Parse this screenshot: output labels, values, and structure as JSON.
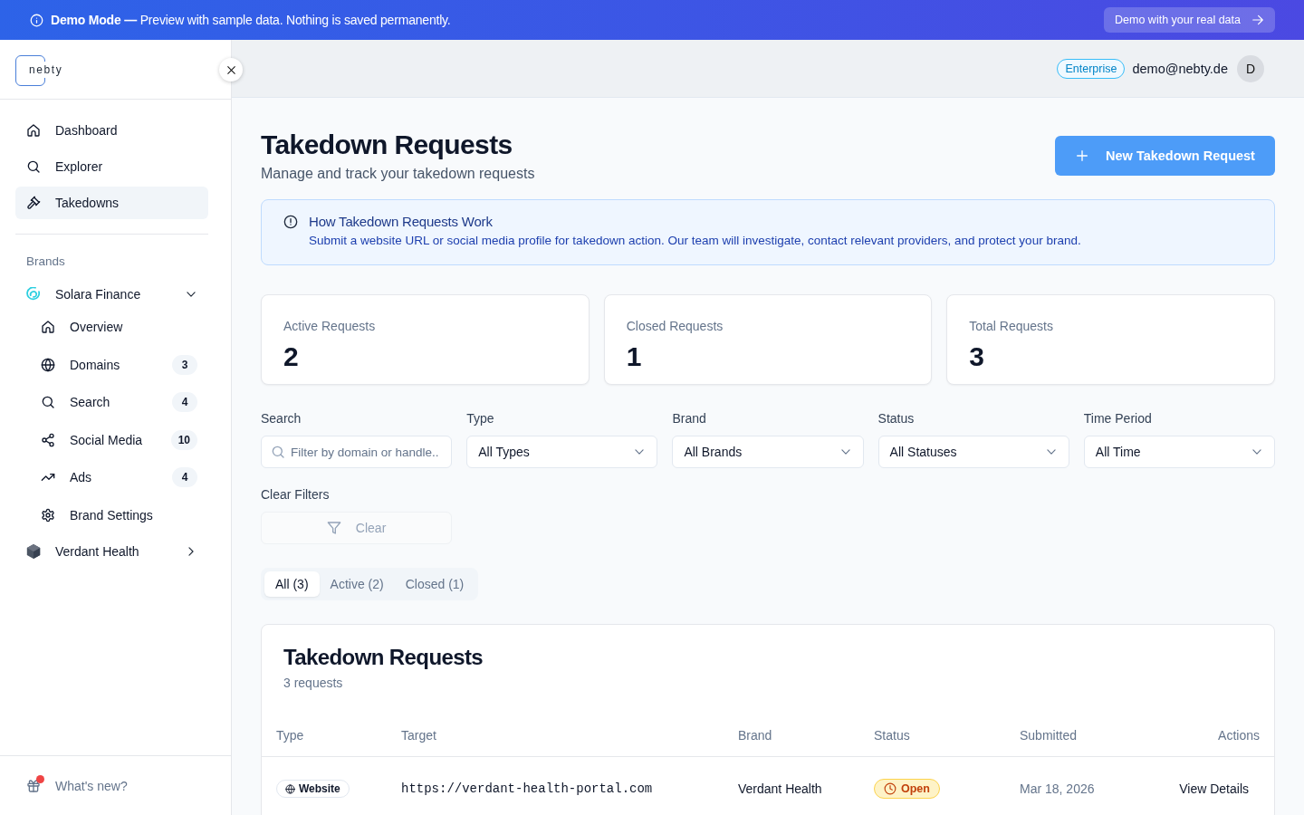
{
  "banner": {
    "message": "**Demo Mode —** Preview with sample data. Nothing is saved permanently.",
    "action": "Demo with your real data"
  },
  "sidebar": {
    "logo": "nebty",
    "nav": [
      {
        "label": "Dashboard",
        "selected": false
      },
      {
        "label": "Explorer",
        "selected": false
      },
      {
        "label": "Takedowns",
        "selected": true
      }
    ],
    "brands_heading": "Brands",
    "brands": [
      {
        "name": "Solara Finance",
        "expanded": true,
        "children": [
          {
            "label": "Overview",
            "selected": false
          },
          {
            "label": "Domains",
            "count": "3",
            "selected": false
          },
          {
            "label": "Search",
            "count": "4",
            "selected": false
          },
          {
            "label": "Social Media",
            "count": "10",
            "selected": false
          },
          {
            "label": "Ads",
            "count": "4",
            "selected": false
          },
          {
            "label": "Brand Settings",
            "selected": false
          }
        ]
      },
      {
        "name": "Verdant Health",
        "expanded": false
      }
    ],
    "footer": {
      "label": "What's new?",
      "unread": true
    }
  },
  "header": {
    "plan": "Enterprise",
    "email": "demo@nebty.de",
    "avatar": "D"
  },
  "page": {
    "title": "Takedown Requests",
    "subtitle": "Manage and track your takedown requests",
    "new_button": "New Takedown Request"
  },
  "info": {
    "title": "How Takedown Requests Work",
    "text": "Submit a website URL or social media profile for takedown action. Our team will investigate, contact relevant providers, and protect your brand."
  },
  "stats": [
    {
      "label": "Active Requests",
      "value": "2"
    },
    {
      "label": "Closed Requests",
      "value": "1"
    },
    {
      "label": "Total Requests",
      "value": "3"
    }
  ],
  "filters": [
    {
      "label": "Search",
      "kind": "search",
      "placeholder": "Filter by domain or handle.."
    },
    {
      "label": "Type",
      "kind": "select",
      "value": "All Types"
    },
    {
      "label": "Brand",
      "kind": "select",
      "value": "All Brands"
    },
    {
      "label": "Status",
      "kind": "select",
      "value": "All Statuses"
    },
    {
      "label": "Time Period",
      "kind": "select",
      "value": "All Time"
    }
  ],
  "clear_filters": {
    "label": "Clear Filters",
    "button": "Clear",
    "disabled": true
  },
  "tabs": [
    {
      "label": "All (3)",
      "selected": true
    },
    {
      "label": "Active (2)",
      "selected": false
    },
    {
      "label": "Closed (1)",
      "selected": false
    }
  ],
  "table": {
    "title": "Takedown Requests",
    "subtitle": "3 requests",
    "columns": [
      "Type",
      "Target",
      "Brand",
      "Status",
      "Submitted",
      "Actions"
    ],
    "rows": [
      {
        "type": "Website",
        "target": "https://verdant-health-portal.com",
        "brand": "Verdant Health",
        "status": "Open",
        "submitted": "Mar 18, 2026",
        "action": "View Details"
      }
    ]
  }
}
